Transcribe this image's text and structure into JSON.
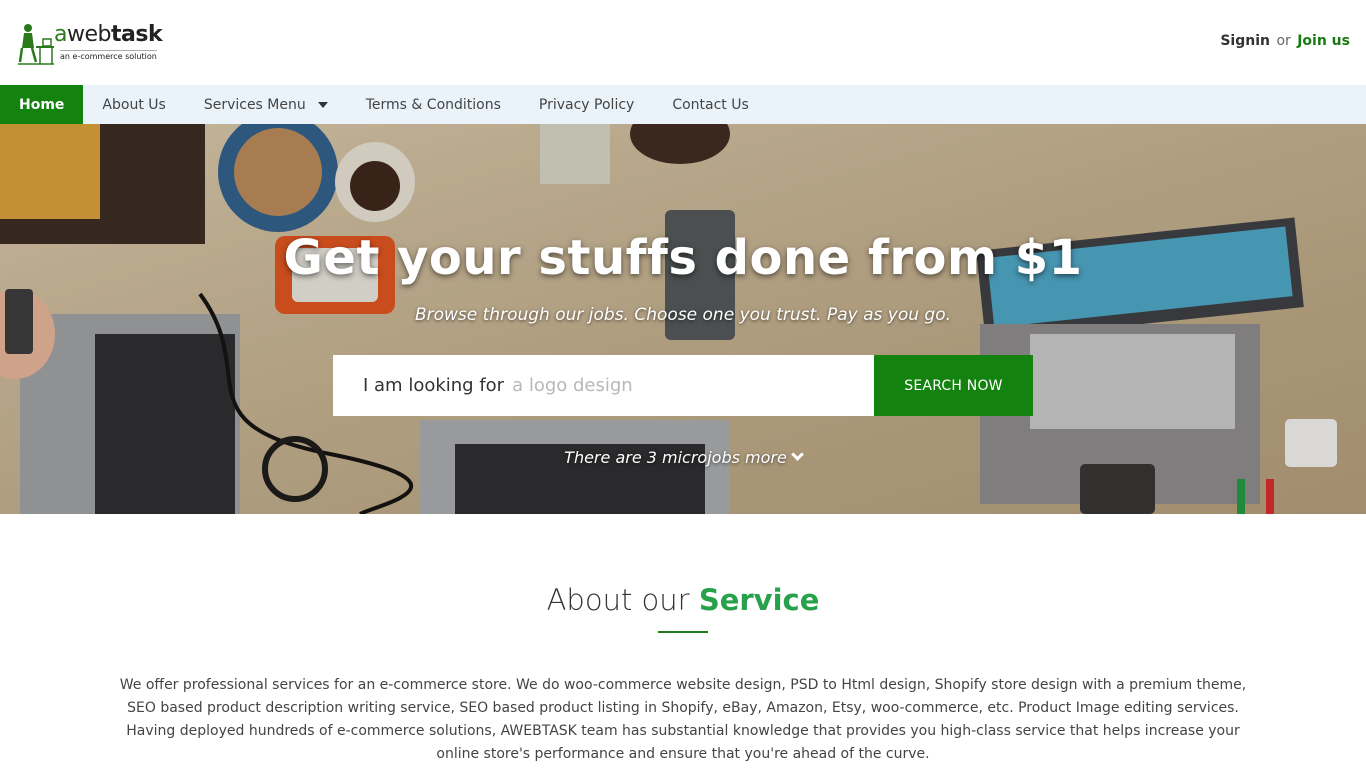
{
  "header": {
    "logo_text_a": "a",
    "logo_text_web": "web",
    "logo_text_task": "task",
    "logo_tagline": "an e-commerce solution",
    "signin_label": "Signin",
    "or_label": "or",
    "join_label": "Join us"
  },
  "nav": {
    "items": [
      {
        "label": "Home",
        "active": true
      },
      {
        "label": "About Us"
      },
      {
        "label": "Services Menu",
        "dropdown": true
      },
      {
        "label": "Terms & Conditions"
      },
      {
        "label": "Privacy Policy"
      },
      {
        "label": "Contact Us"
      }
    ]
  },
  "hero": {
    "title": "Get your stuffs done from $1",
    "subtitle": "Browse through our jobs. Choose one you trust. Pay as you go.",
    "search_prefix": "I am looking for",
    "search_placeholder": "a logo design",
    "search_button": "SEARCH NOW",
    "more_text": "There are 3 microjobs more"
  },
  "about": {
    "title_plain": "About our",
    "title_highlight": "Service",
    "body": "We offer professional services for an e-commerce store. We do woo-commerce website design, PSD to Html design, Shopify store design with a premium theme, SEO based product description writing service, SEO based product listing in Shopify, eBay, Amazon, Etsy, woo-commerce, etc. Product Image editing services. Having deployed hundreds of e-commerce solutions, AWEBTASK team has substantial knowledge that provides you high-class service that helps increase your online store's performance and ensure that you're ahead of the curve."
  },
  "colors": {
    "brand_green": "#13820f",
    "highlight_green": "#28a14b",
    "nav_background": "#eaf3fa"
  }
}
